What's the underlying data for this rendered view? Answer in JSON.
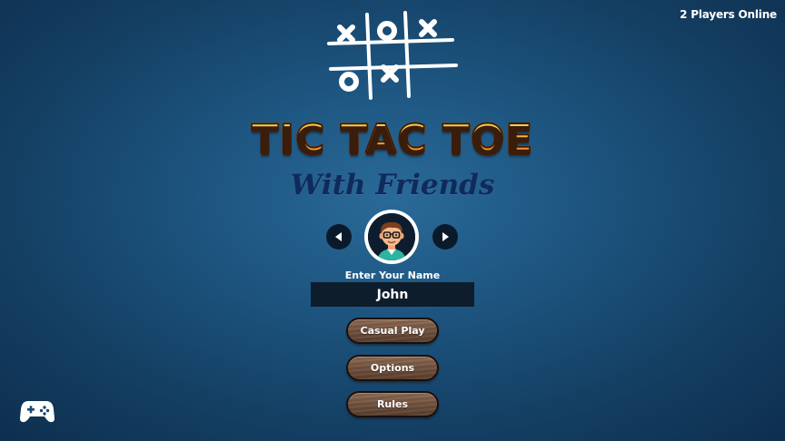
{
  "status": {
    "players_online": "2 Players Online"
  },
  "logo": {
    "icon": "tic-tac-toe-board-icon",
    "title": "TIC TAC TOE",
    "subtitle": "With Friends"
  },
  "avatar_selector": {
    "prev_icon": "chevron-left-icon",
    "next_icon": "chevron-right-icon",
    "avatar_icon": "nerd-boy-avatar"
  },
  "name_field": {
    "label": "Enter Your Name",
    "value": "John"
  },
  "menu": {
    "casual_play": "Casual Play",
    "options": "Options",
    "rules": "Rules"
  },
  "footer": {
    "controller_icon": "gamepad-icon"
  },
  "colors": {
    "background": "#1d5580",
    "title_fill": "#f6b430",
    "subtitle": "#102a5c",
    "input_bg": "#0e1d2c",
    "button_wood": "#6e4f3c"
  }
}
